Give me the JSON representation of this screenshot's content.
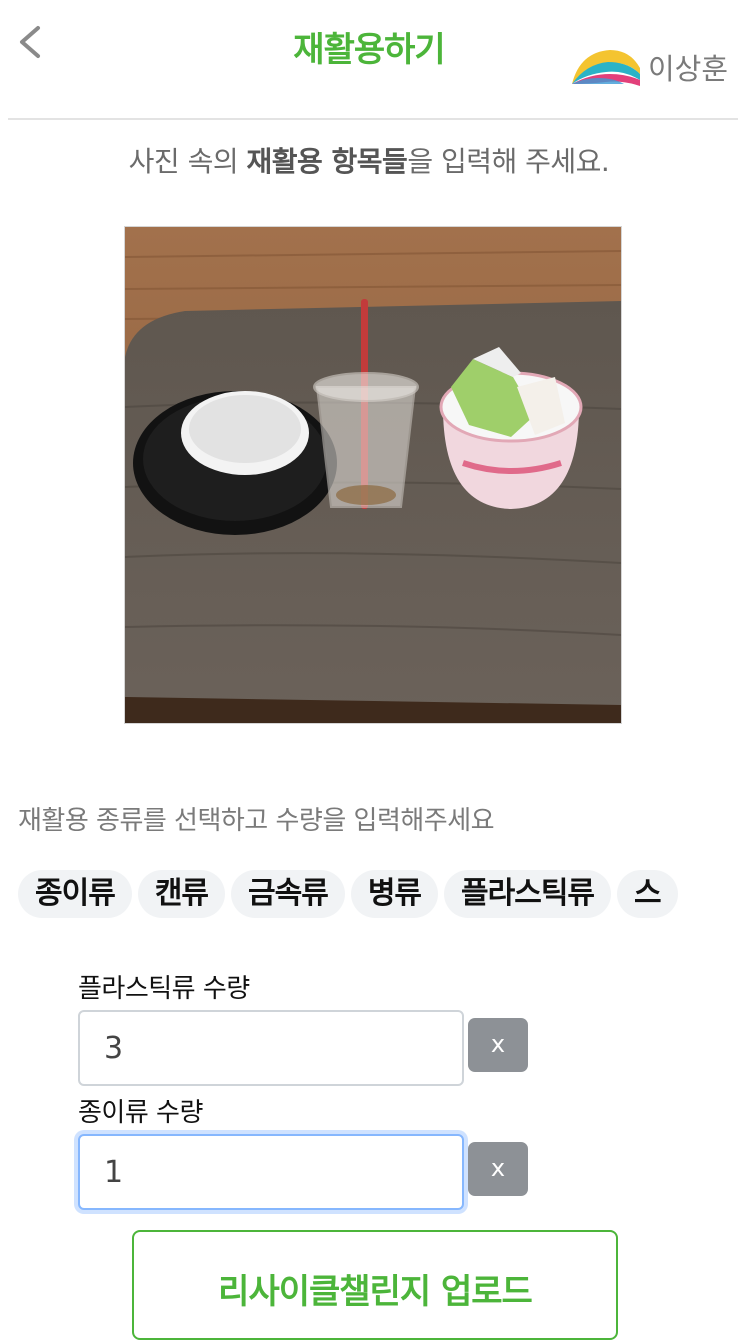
{
  "header": {
    "title": "재활용하기",
    "user_name": "이상훈",
    "back_icon": "chevron-left-icon",
    "logo_icon": "rainbow-logo-icon"
  },
  "instruction": {
    "prefix": "사진 속의 ",
    "bold": "재활용 항목들",
    "suffix": "을 입력해 주세요."
  },
  "photo": {
    "alt": "재활용 사진"
  },
  "category_section": {
    "label": "재활용 종류를 선택하고 수량을 입력해주세요",
    "chips": [
      "종이류",
      "캔류",
      "금속류",
      "병류",
      "플라스틱류",
      "스"
    ]
  },
  "quantities": [
    {
      "label": "플라스틱류 수량",
      "value": "3",
      "remove_label": "x"
    },
    {
      "label": "종이류 수량",
      "value": "1",
      "remove_label": "x"
    }
  ],
  "upload_button": "리사이클챌린지 업로드",
  "colors": {
    "accent": "#4cb53a",
    "chip_bg": "#f1f3f5",
    "remove_button": "#8d9196",
    "focus": "#86b7fe"
  }
}
